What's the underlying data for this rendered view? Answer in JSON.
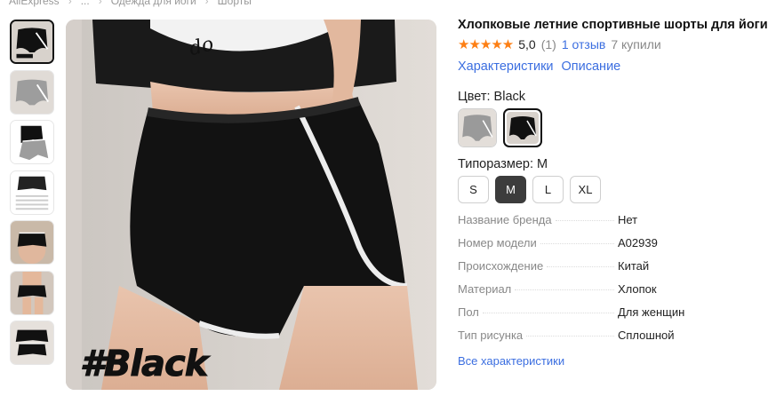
{
  "breadcrumb": [
    "AliExpress",
    "...",
    "Одежда для йоги",
    "Шорты"
  ],
  "product": {
    "title": "Хлопковые летние спортивные шорты для йоги",
    "stars": "★★★★★",
    "score": "5,0",
    "rating_count": "(1)",
    "reviews": "1 отзыв",
    "bought": "7 купили"
  },
  "links": {
    "characteristics": "Характеристики",
    "description": "Описание"
  },
  "color": {
    "label": "Цвет: Black",
    "options": [
      "grey",
      "black"
    ],
    "selected": "black"
  },
  "size": {
    "label": "Типоразмер: M",
    "options": [
      "S",
      "M",
      "L",
      "XL"
    ],
    "selected": "M"
  },
  "image": {
    "caption": "#Black"
  },
  "specs": [
    {
      "key": "Название бренда",
      "value": "Нет"
    },
    {
      "key": "Номер модели",
      "value": "A02939"
    },
    {
      "key": "Происхождение",
      "value": "Китай"
    },
    {
      "key": "Материал",
      "value": "Хлопок"
    },
    {
      "key": "Пол",
      "value": "Для женщин"
    },
    {
      "key": "Тип рисунка",
      "value": "Сплошной"
    }
  ],
  "all_specs_link": "Все характеристики",
  "colors": {
    "accent": "#3b6ee0",
    "star": "#fd7f14",
    "selected": "#3c3c3c"
  }
}
